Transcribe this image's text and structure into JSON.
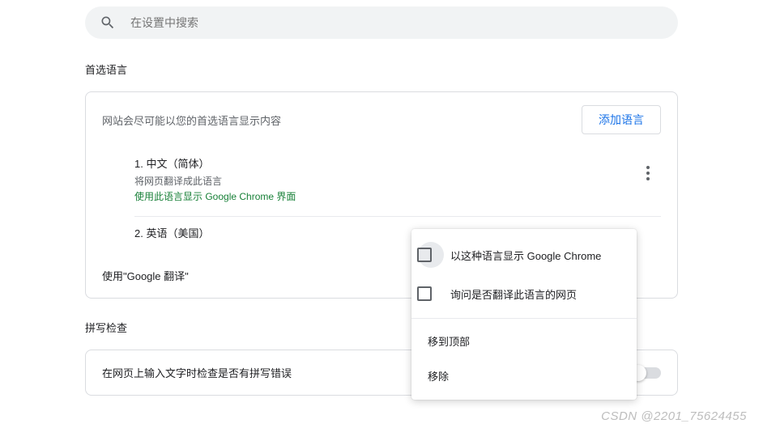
{
  "search": {
    "placeholder": "在设置中搜索"
  },
  "sections": {
    "preferred_languages_title": "首选语言",
    "card_desc": "网站会尽可能以您的首选语言显示内容",
    "add_language_btn": "添加语言",
    "languages": [
      {
        "index": "1.",
        "name": "中文（简体）",
        "sub_translate": "将网页翻译成此语言",
        "sub_display": "使用此语言显示 Google Chrome 界面"
      },
      {
        "index": "2.",
        "name": "英语（美国）"
      }
    ],
    "google_translate": "使用\"Google 翻译\"",
    "spell_check_title": "拼写检查",
    "spell_check_desc": "在网页上输入文字时检查是否有拼写错误"
  },
  "menu": {
    "display_chrome": "以这种语言显示 Google Chrome",
    "ask_translate": "询问是否翻译此语言的网页",
    "move_top": "移到顶部",
    "remove": "移除"
  },
  "watermark": "CSDN @2201_75624455"
}
